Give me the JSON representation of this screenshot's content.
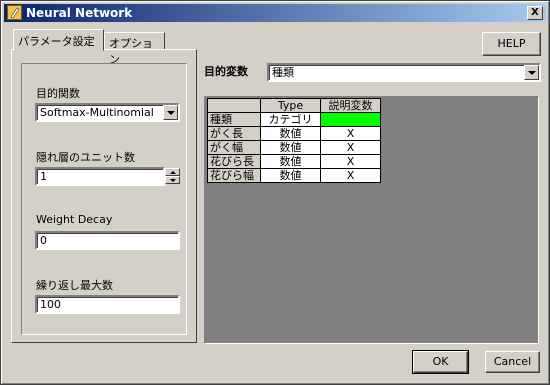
{
  "window": {
    "title": "Neural Network",
    "close_glyph": "X"
  },
  "tabs": [
    {
      "label": "パラメータ設定"
    },
    {
      "label": "オプション"
    }
  ],
  "help_label": "HELP",
  "params": {
    "objective_label": "目的関数",
    "objective_value": "Softmax-Multinomial",
    "hidden_units_label": "隠れ層のユニット数",
    "hidden_units_value": "1",
    "weight_decay_label": "Weight Decay",
    "weight_decay_value": "0",
    "max_iter_label": "繰り返し最大数",
    "max_iter_value": "100"
  },
  "target": {
    "label": "目的変数",
    "value": "種類"
  },
  "grid": {
    "headers": [
      "",
      "Type",
      "説明変数"
    ],
    "rows": [
      {
        "name": "種類",
        "type": "カテゴリ",
        "mark": "",
        "highlight": true
      },
      {
        "name": "がく長",
        "type": "数値",
        "mark": "X"
      },
      {
        "name": "がく幅",
        "type": "数値",
        "mark": "X"
      },
      {
        "name": "花びら長",
        "type": "数値",
        "mark": "X"
      },
      {
        "name": "花びら幅",
        "type": "数値",
        "mark": "X"
      }
    ],
    "highlight_color": "#00ff00"
  },
  "buttons": {
    "ok": "OK",
    "cancel": "Cancel"
  }
}
